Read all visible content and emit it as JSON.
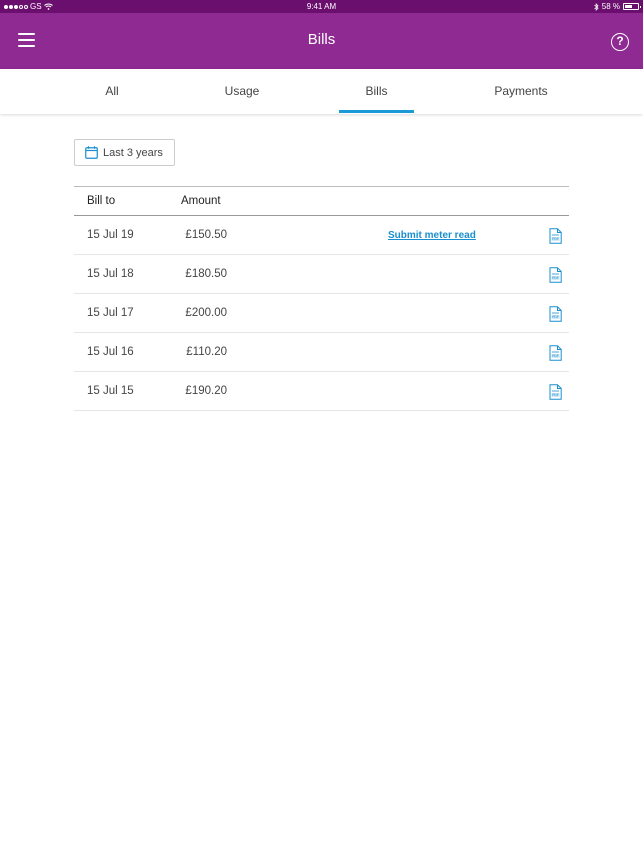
{
  "status_bar": {
    "carrier": "GS",
    "time": "9:41 AM",
    "battery_pct": "58 %",
    "battery_level": 0.58
  },
  "header": {
    "title": "Bills"
  },
  "tabs": [
    {
      "label": "All",
      "active": false
    },
    {
      "label": "Usage",
      "active": false
    },
    {
      "label": "Bills",
      "active": true
    },
    {
      "label": "Payments",
      "active": false
    }
  ],
  "filter": {
    "range_label": "Last 3 years"
  },
  "table": {
    "headers": {
      "bill_to": "Bill to",
      "amount": "Amount"
    },
    "rows": [
      {
        "date": "15 Jul 19",
        "amount": "£150.50",
        "action": "Submit meter read"
      },
      {
        "date": "15 Jul 18",
        "amount": "£180.50",
        "action": ""
      },
      {
        "date": "15 Jul 17",
        "amount": "£200.00",
        "action": ""
      },
      {
        "date": "15 Jul 16",
        "amount": "£110.20",
        "action": ""
      },
      {
        "date": "15 Jul 15",
        "amount": "£190.20",
        "action": ""
      }
    ]
  },
  "colors": {
    "header_bg": "#8e2a91",
    "status_bg": "#6a0f6e",
    "accent": "#1a9ad6",
    "link": "#1a8fcf"
  },
  "icons": {
    "menu": "hamburger-icon",
    "help": "help-circle-icon",
    "calendar": "calendar-icon",
    "pdf": "pdf-file-icon"
  }
}
